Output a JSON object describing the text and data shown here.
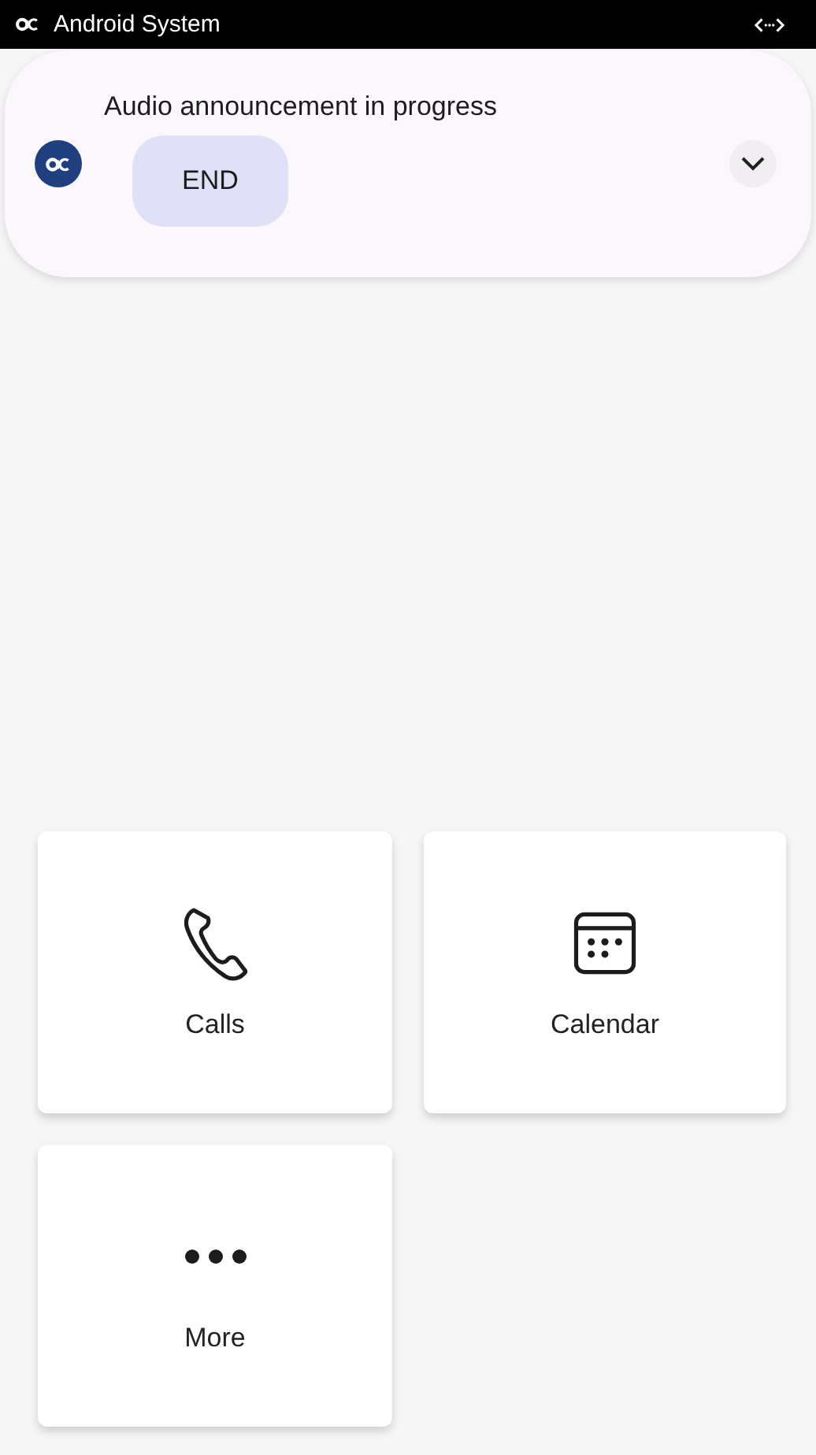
{
  "status_bar": {
    "app_name": "Android System"
  },
  "notification": {
    "title": "Audio announcement in progress",
    "action": "END",
    "expanded": false
  },
  "tiles": [
    {
      "kind": "phone",
      "label": "Calls"
    },
    {
      "kind": "calendar",
      "label": "Calendar"
    },
    {
      "kind": "more",
      "label": "More"
    }
  ]
}
